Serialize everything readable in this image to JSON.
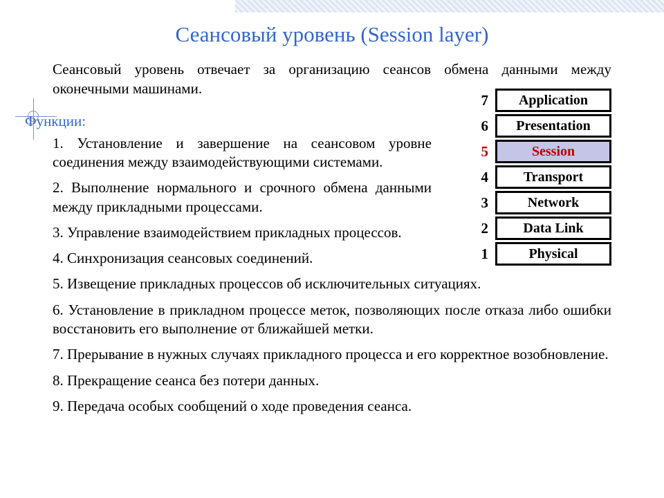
{
  "title": "Сеансовый уровень (Session layer)",
  "intro": "Сеансовый уровень отвечает за организацию сеансов обмена данными между оконечными машинами.",
  "functions_label": "Функции:",
  "functions": [
    "1. Установление и завершение на сеансовом уровне соединения между взаимодействующими системами.",
    "2. Выполнение нормального и срочного обмена данными между прикладными процессами.",
    "3. Управление взаимодействием прикладных процессов.",
    "4.  Синхронизация сеансовых соединений.",
    "5.  Извещение прикладных процессов об исключительных ситуациях.",
    "6. Установление в прикладном процессе меток, позволяющих после отказа либо ошибки восстановить его выполнение от ближайшей метки.",
    "7. Прерывание в нужных случаях прикладного процесса и его корректное возобновление.",
    "8.  Прекращение сеанса без потери данных.",
    "9. Передача особых сообщений о ходе проведения сеанса."
  ],
  "osi": [
    {
      "num": "7",
      "name": "Application",
      "highlight": false
    },
    {
      "num": "6",
      "name": "Presentation",
      "highlight": false
    },
    {
      "num": "5",
      "name": "Session",
      "highlight": true
    },
    {
      "num": "4",
      "name": "Transport",
      "highlight": false
    },
    {
      "num": "3",
      "name": "Network",
      "highlight": false
    },
    {
      "num": "2",
      "name": "Data Link",
      "highlight": false
    },
    {
      "num": "1",
      "name": "Physical",
      "highlight": false
    }
  ]
}
